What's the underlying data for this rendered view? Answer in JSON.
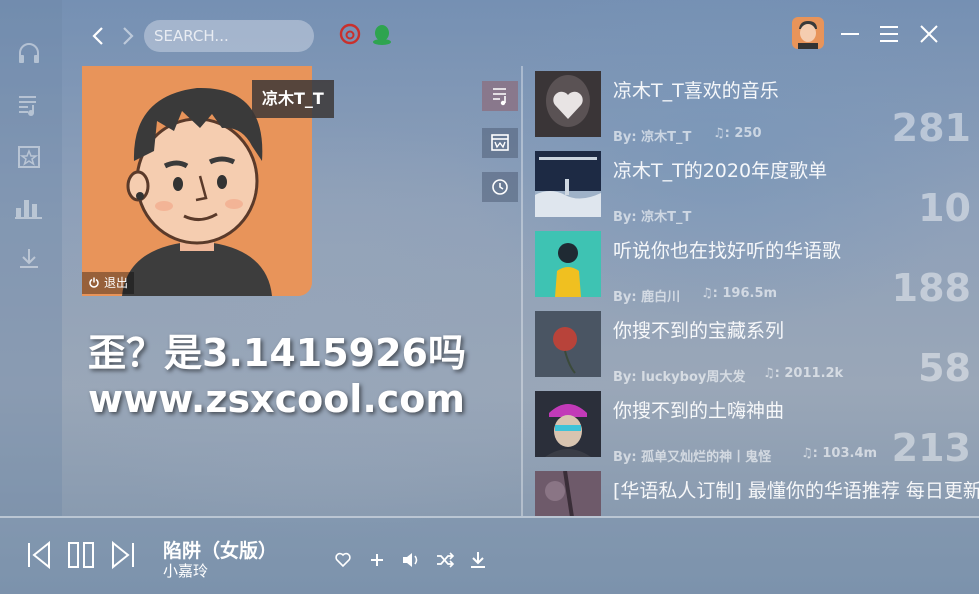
{
  "colors": {
    "accent": "#e8945a",
    "netease_red": "#c9302c",
    "qq_green": "#2ea44f"
  },
  "search": {
    "placeholder": "SEARCH..."
  },
  "sidebar": {
    "items": [
      {
        "icon": "headphones-icon"
      },
      {
        "icon": "music-list-icon"
      },
      {
        "icon": "star-box-icon"
      },
      {
        "icon": "bar-chart-icon"
      },
      {
        "icon": "download-icon"
      }
    ]
  },
  "profile": {
    "username": "凉木T_T",
    "logout_label": "退出"
  },
  "watermark": {
    "line1": "歪？是3.1415926吗",
    "line2": "www.zsxcool.com"
  },
  "side_tabs": [
    {
      "icon": "playlist-icon",
      "active": true
    },
    {
      "icon": "calendar-icon",
      "active": false
    },
    {
      "icon": "history-icon",
      "active": false
    }
  ],
  "playlists": [
    {
      "title": "凉木T_T喜欢的音乐",
      "by": "By: 凉木T_T",
      "plays": ": 250",
      "count": "281"
    },
    {
      "title": "凉木T_T的2020年度歌单",
      "by": "By: 凉木T_T",
      "plays": "",
      "count": "10"
    },
    {
      "title": "听说你也在找好听的华语歌",
      "by": "By: 鹿白川",
      "plays": ": 196.5m",
      "count": "188"
    },
    {
      "title": "你搜不到的宝藏系列",
      "by": "By: luckyboy周大发",
      "plays": ": 2011.2k",
      "count": "58"
    },
    {
      "title": "你搜不到的土嗨神曲",
      "by": "By: 孤单又灿烂的神丨鬼怪",
      "plays": ": 103.4m",
      "count": "213"
    },
    {
      "title": "[华语私人订制] 最懂你的华语推荐 每日更新",
      "by": "",
      "plays": "",
      "count": ""
    }
  ],
  "player": {
    "song_title": "陷阱（女版）",
    "artist": "小嘉玲"
  }
}
